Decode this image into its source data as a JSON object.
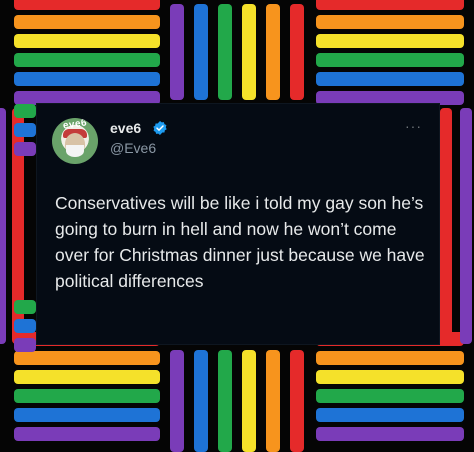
{
  "tweet": {
    "display_name": "eve6",
    "verified_icon": "verified-badge-icon",
    "handle": "@Eve6",
    "more_label": "···",
    "avatar_text": "eve6",
    "text": "Conservatives will be like i told my gay son he’s going to burn in hell and now he won’t come over for Christmas dinner just because we have political differences"
  },
  "colors": {
    "background": "#050505",
    "card": "#050b14",
    "text": "#e7e9ea",
    "handle": "#8b98a5",
    "verified": "#1d9bf0",
    "stripes": [
      "#e52a2a",
      "#f7941d",
      "#f5e12a",
      "#22a84a",
      "#1e73d6",
      "#7a3cb8"
    ]
  }
}
